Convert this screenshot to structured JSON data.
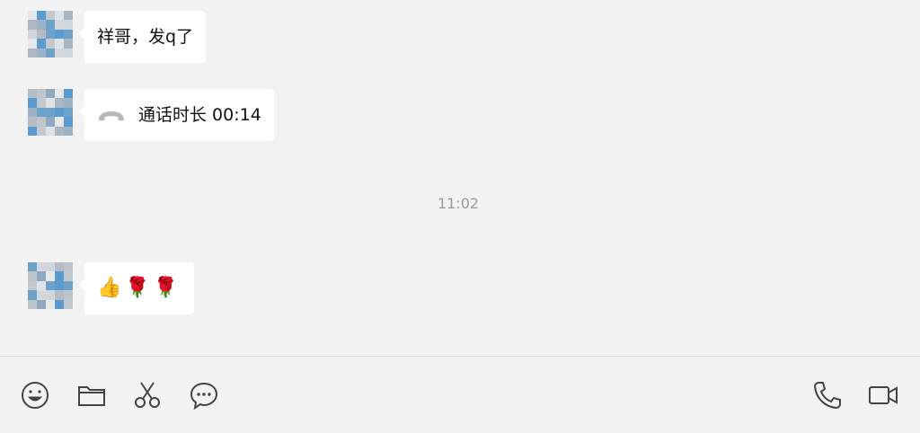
{
  "messages": [
    {
      "type": "text",
      "text": "祥哥，发q了"
    },
    {
      "type": "call",
      "text": "通话时长 00:14",
      "icon": "phone-hangup-icon"
    },
    {
      "type": "emoji",
      "emojis": [
        "👍",
        "🌹",
        "🌹"
      ]
    }
  ],
  "timestamp": "11:02",
  "toolbar": {
    "left_icons": [
      "emoji-icon",
      "folder-icon",
      "scissors-icon",
      "chat-bubble-icon"
    ],
    "right_icons": [
      "phone-icon",
      "video-camera-icon"
    ]
  },
  "colors": {
    "background": "#f2f2f2",
    "bubble": "#ffffff",
    "timestamp": "#9b9b9b",
    "icon": "#444444"
  }
}
